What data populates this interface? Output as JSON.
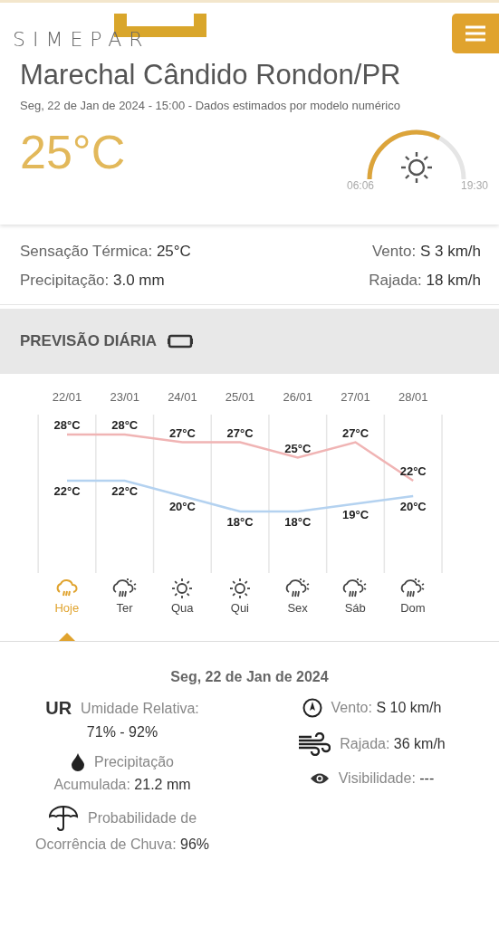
{
  "header": {
    "logo": "SIMEPAR"
  },
  "current": {
    "city": "Marechal Cândido Rondon/PR",
    "subtitle": "Seg, 22 de Jan de 2024 - 15:00 - Dados estimados por modelo numérico",
    "temperature": "25°C",
    "sunrise": "06:06",
    "sunset": "19:30"
  },
  "conditions": [
    {
      "label": "Sensação Térmica:",
      "value": "25°C"
    },
    {
      "label": "Vento:",
      "value": "S 3 km/h"
    },
    {
      "label": "Precipitação:",
      "value": "3.0 mm"
    },
    {
      "label": "Rajada:",
      "value": "18 km/h"
    }
  ],
  "daily": {
    "title": "PREVISÃO DIÁRIA",
    "chart_data": {
      "type": "line",
      "categories": [
        "22/01",
        "23/01",
        "24/01",
        "25/01",
        "26/01",
        "27/01",
        "28/01"
      ],
      "series": [
        {
          "color": "#f0b4b4",
          "values": [
            28,
            28,
            27,
            27,
            25,
            27,
            22
          ],
          "value_labels": [
            "28°C",
            "28°C",
            "27°C",
            "27°C",
            "25°C",
            "27°C",
            "22°C"
          ]
        },
        {
          "color": "#b4d2f0",
          "values": [
            22,
            22,
            20,
            18,
            18,
            19,
            20
          ],
          "value_labels": [
            "22°C",
            "22°C",
            "20°C",
            "18°C",
            "18°C",
            "19°C",
            "20°C"
          ]
        }
      ]
    },
    "days": [
      {
        "label": "Hoje",
        "kind": "rain",
        "selected": true
      },
      {
        "label": "Ter",
        "kind": "rain-sun",
        "selected": false
      },
      {
        "label": "Qua",
        "kind": "sun",
        "selected": false
      },
      {
        "label": "Qui",
        "kind": "sun",
        "selected": false
      },
      {
        "label": "Sex",
        "kind": "rain-sun",
        "selected": false
      },
      {
        "label": "Sáb",
        "kind": "rain-sun",
        "selected": false
      },
      {
        "label": "Dom",
        "kind": "rain-sun",
        "selected": false
      }
    ]
  },
  "details": {
    "date": "Seg, 22 de Jan de 2024",
    "left": [
      {
        "kind": "humidity",
        "badge": "UR",
        "title": "Umidade Relativa:",
        "value": "71% - 92%"
      },
      {
        "kind": "drop",
        "title": "Precipitação",
        "label": "Acumulada:",
        "value": "21.2 mm"
      },
      {
        "kind": "umbrella",
        "title": "Probabilidade de",
        "label": "Ocorrência de Chuva:",
        "value": "96%"
      }
    ],
    "right": [
      {
        "kind": "compass",
        "label": "Vento:",
        "value": "S 10 km/h"
      },
      {
        "kind": "wind",
        "label": "Rajada:",
        "value": "36 km/h"
      },
      {
        "kind": "eye",
        "label": "Visibilidade:",
        "value": "---"
      }
    ]
  }
}
